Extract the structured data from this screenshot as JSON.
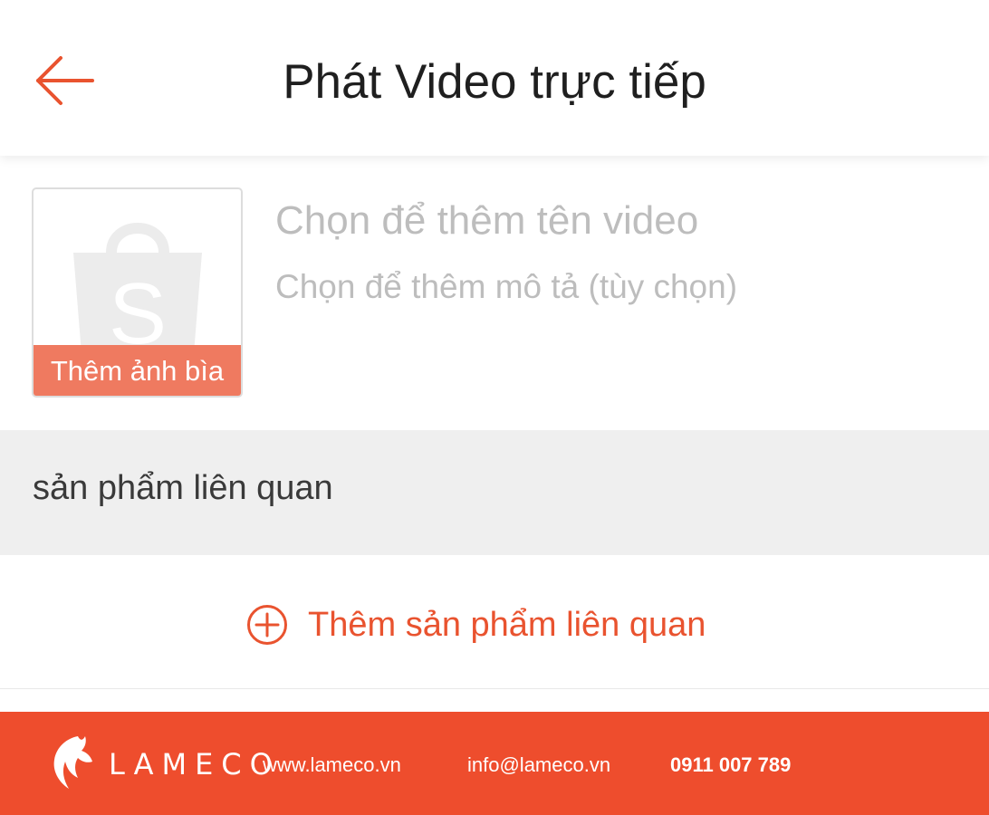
{
  "header": {
    "title": "Phát Video trực tiếp",
    "back_icon": "arrow-left-icon"
  },
  "video_info": {
    "cover_label": "Thêm ảnh bìa",
    "cover_placeholder_icon": "shopping-bag-icon",
    "title_placeholder": "Chọn để thêm tên video",
    "description_placeholder": "Chọn để thêm mô tả (tùy chọn)"
  },
  "related_products": {
    "section_label": "sản phẩm liên quan",
    "add_label": "Thêm sản phẩm liên quan",
    "add_icon": "plus-circle-icon"
  },
  "footer": {
    "brand": "LAMECO",
    "website": "www.lameco.vn",
    "email": "info@lameco.vn",
    "phone": "0911 007 789"
  },
  "colors": {
    "accent": "#ee4d2d",
    "cover_label_bg": "#ef7a60",
    "placeholder_text": "#bdbdbd",
    "section_bg": "#efefef"
  }
}
